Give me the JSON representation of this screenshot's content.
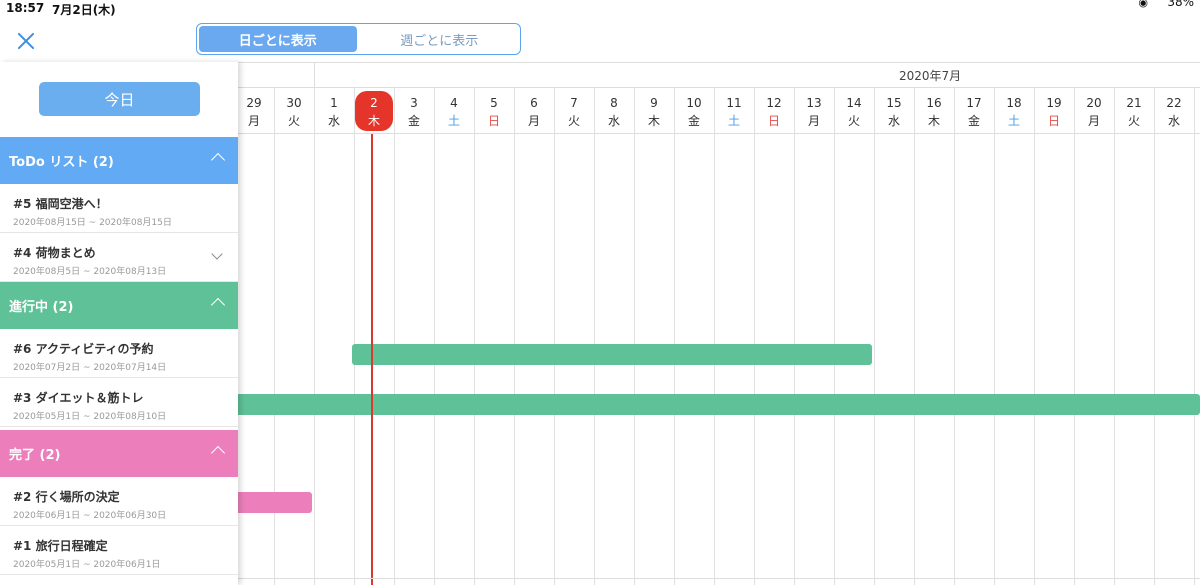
{
  "status_bar": {
    "time": "18:57",
    "date": "7月2日(木)",
    "battery": "38%",
    "wifi_icon": "wifi-icon"
  },
  "nav": {
    "close_icon": "close-icon",
    "segments": [
      {
        "label": "日ごとに表示",
        "active": true
      },
      {
        "label": "週ごとに表示",
        "active": false
      }
    ]
  },
  "sidebar": {
    "today_button": "今日",
    "groups": [
      {
        "label": "ToDo リスト (2)",
        "color": "#62aaf3",
        "tasks": [
          {
            "title": "#5 福岡空港へ！",
            "range": "2020年08月15日 ~ 2020年08月15日"
          },
          {
            "title": "#4 荷物まとめ",
            "range": "2020年08月5日 ~ 2020年08月13日",
            "expand_icon": "chevron-down-icon"
          }
        ]
      },
      {
        "label": "進行中 (2)",
        "color": "#5fc197",
        "tasks": [
          {
            "title": "#6 アクティビティの予約",
            "range": "2020年07月2日 ~ 2020年07月14日"
          },
          {
            "title": "#3 ダイエット＆筋トレ",
            "range": "2020年05月1日 ~ 2020年08月10日"
          }
        ]
      },
      {
        "label": "完了 (2)",
        "color": "#ec7fbb",
        "tasks": [
          {
            "title": "#2 行く場所の決定",
            "range": "2020年06月1日 ~ 2020年06月30日"
          },
          {
            "title": "#1 旅行日程確定",
            "range": "2020年05月1日 ~ 2020年06月1日"
          }
        ]
      }
    ]
  },
  "timeline": {
    "month_label": "2020年7月",
    "days": [
      {
        "n": "29",
        "w": "月"
      },
      {
        "n": "30",
        "w": "火"
      },
      {
        "n": "1",
        "w": "水"
      },
      {
        "n": "2",
        "w": "木",
        "today": true
      },
      {
        "n": "3",
        "w": "金"
      },
      {
        "n": "4",
        "w": "土",
        "type": "sat"
      },
      {
        "n": "5",
        "w": "日",
        "type": "sun"
      },
      {
        "n": "6",
        "w": "月"
      },
      {
        "n": "7",
        "w": "火"
      },
      {
        "n": "8",
        "w": "水"
      },
      {
        "n": "9",
        "w": "木"
      },
      {
        "n": "10",
        "w": "金"
      },
      {
        "n": "11",
        "w": "土",
        "type": "sat"
      },
      {
        "n": "12",
        "w": "日",
        "type": "sun"
      },
      {
        "n": "13",
        "w": "月"
      },
      {
        "n": "14",
        "w": "火"
      },
      {
        "n": "15",
        "w": "水"
      },
      {
        "n": "16",
        "w": "木"
      },
      {
        "n": "17",
        "w": "金"
      },
      {
        "n": "18",
        "w": "土",
        "type": "sat"
      },
      {
        "n": "19",
        "w": "日",
        "type": "sun"
      },
      {
        "n": "20",
        "w": "月"
      },
      {
        "n": "21",
        "w": "火"
      },
      {
        "n": "22",
        "w": "水"
      }
    ]
  }
}
